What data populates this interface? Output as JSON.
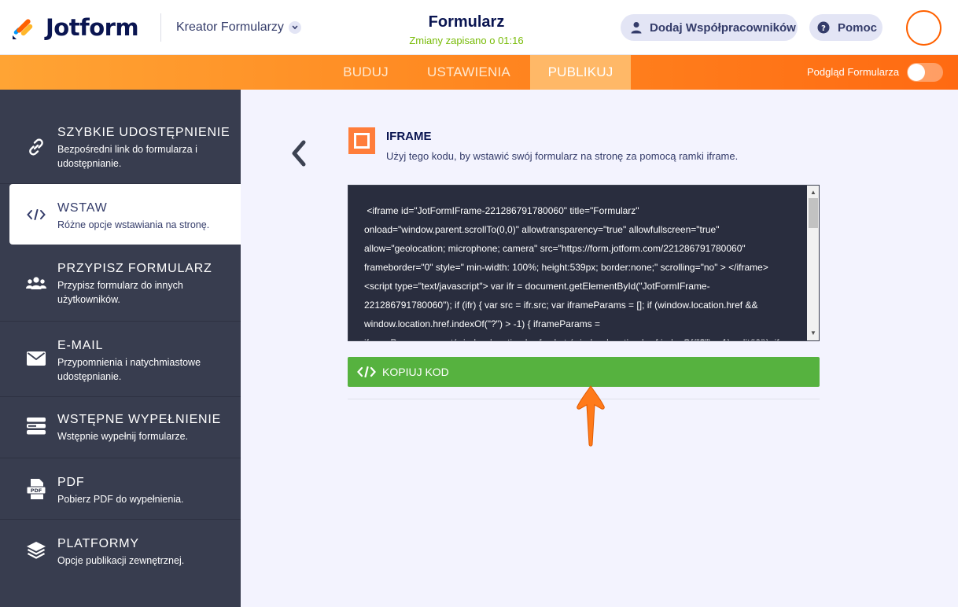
{
  "header": {
    "logo_text": "Jotform",
    "builder_label": "Kreator Formularzy",
    "form_title": "Formularz",
    "save_status": "Zmiany zapisano o 01:16",
    "collaborators_label": "Dodaj Współpracowników",
    "help_label": "Pomoc"
  },
  "nav": {
    "tabs": [
      {
        "label": "BUDUJ"
      },
      {
        "label": "USTAWIENIA"
      },
      {
        "label": "PUBLIKUJ"
      }
    ],
    "active_tab": "PUBLIKUJ",
    "preview_label": "Podgląd Formularza",
    "preview_enabled": false
  },
  "sidebar": {
    "items": [
      {
        "title": "SZYBKIE UDOSTĘPNIENIE",
        "desc": "Bezpośredni link do formularza i udostępnianie.",
        "icon": "link-icon"
      },
      {
        "title": "WSTAW",
        "desc": "Różne opcje wstawiania na stronę.",
        "icon": "code-icon"
      },
      {
        "title": "PRZYPISZ FORMULARZ",
        "desc": "Przypisz formularz do innych użytkowników.",
        "icon": "users-icon"
      },
      {
        "title": "E-MAIL",
        "desc": "Przypomnienia i natychmiastowe udostępnianie.",
        "icon": "envelope-icon"
      },
      {
        "title": "WSTĘPNE WYPEŁNIENIE",
        "desc": "Wstępnie wypełnij formularze.",
        "icon": "prefill-icon"
      },
      {
        "title": "PDF",
        "desc": "Pobierz PDF do wypełnienia.",
        "icon": "pdf-icon"
      },
      {
        "title": "PLATFORMY",
        "desc": "Opcje publikacji zewnętrznej.",
        "icon": "layers-icon"
      }
    ],
    "active_index": 1
  },
  "main": {
    "section_title": "IFRAME",
    "section_desc": "Użyj tego kodu, by wstawić swój formularz na stronę za pomocą ramki iframe.",
    "code": " <iframe id=\"JotFormIFrame-221286791780060\" title=\"Formularz\"\nonload=\"window.parent.scrollTo(0,0)\" allowtransparency=\"true\" allowfullscreen=\"true\"\nallow=\"geolocation; microphone; camera\" src=\"https://form.jotform.com/221286791780060\"\nframeborder=\"0\" style=\" min-width: 100%; height:539px; border:none;\" scrolling=\"no\" > </iframe>\n<script type=\"text/javascript\"> var ifr = document.getElementById(\"JotFormIFrame-\n221286791780060\"); if (ifr) { var src = ifr.src; var iframeParams = []; if (window.location.href &&\nwindow.location.href.indexOf(\"?\") > -1) { iframeParams =\niframeParams.concat(window.location.href.substr(window.location.href.indexOf(\"?\") + 1).split('&')); if",
    "copy_button_label": "KOPIUJ KOD"
  },
  "colors": {
    "orange": "#ff6100",
    "green": "#56b23f",
    "sidebar": "#383d4f",
    "code_bg": "#292d3e"
  }
}
